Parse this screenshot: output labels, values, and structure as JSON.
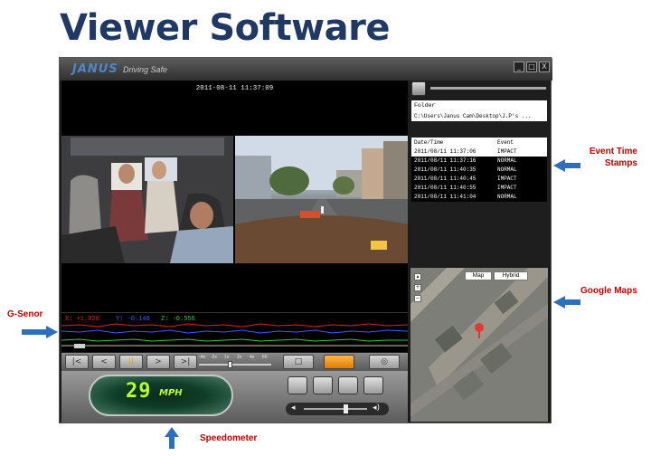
{
  "slide": {
    "title": "Viewer Software"
  },
  "callouts": {
    "event_time_stamps": "Event Time Stamps",
    "google_maps": "Google Maps",
    "g_sensor": "G-Senor",
    "speedometer": "Speedometer"
  },
  "app": {
    "logo": "JANUS",
    "tagline": "Driving Safe",
    "window_buttons": {
      "minimize": "_",
      "maximize": "□",
      "close": "X"
    },
    "video": {
      "timestamp": "2011-08-11 11:37:09"
    },
    "gsensor": {
      "x": "X: +1.028",
      "y": "Y: -0.148",
      "z": "Z: -0.556"
    },
    "playback": {
      "speed_labels": [
        "-4x",
        "-2x",
        "1x",
        "2x",
        "4x",
        "FF"
      ]
    },
    "speedometer": {
      "value": "29",
      "unit": "MPH"
    },
    "files": {
      "folder_label": "Folder",
      "folder_path": "C:\\Users\\Janus Cam\\Desktop\\J.P's ..."
    },
    "events": {
      "headers": [
        "Date/Time",
        "Event"
      ],
      "rows": [
        {
          "datetime": "2011/08/11 11:37:06",
          "event": "IMPACT"
        },
        {
          "datetime": "2011/08/11 11:37:16",
          "event": "NORMAL"
        },
        {
          "datetime": "2011/08/11 11:40:35",
          "event": "NORMAL"
        },
        {
          "datetime": "2011/08/11 11:40:45",
          "event": "IMPACT"
        },
        {
          "datetime": "2011/08/11 11:40:55",
          "event": "IMPACT"
        },
        {
          "datetime": "2011/08/11 11:41:04",
          "event": "NORMAL"
        }
      ]
    },
    "map": {
      "tab_map": "Map",
      "tab_hybrid": "Hybrid",
      "zoom_in": "+",
      "zoom_out": "−"
    }
  },
  "colors": {
    "title": "#1f3864",
    "callout_text": "#c00000",
    "arrow": "#2e6fbd",
    "speed_digits": "#b7ff2a",
    "gx": "#e02020",
    "gy": "#3a5bff",
    "gz": "#2ecc40"
  }
}
